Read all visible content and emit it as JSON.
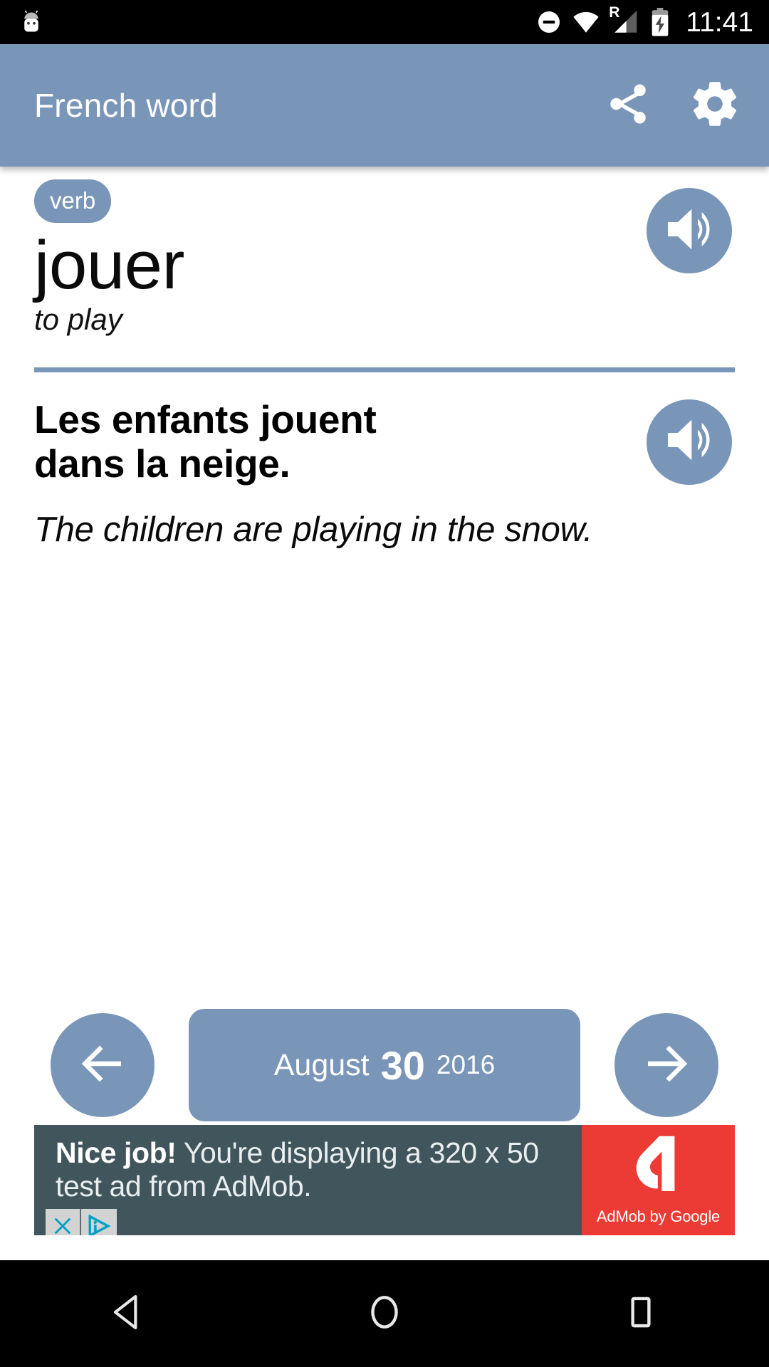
{
  "status_bar": {
    "notification_icon": "android-robot-icon",
    "dnd_icon": "do-not-disturb-icon",
    "wifi_icon": "wifi-icon",
    "roaming_label": "R",
    "signal_icon": "cellular-signal-icon",
    "battery_icon": "battery-charging-icon",
    "clock": "11:41"
  },
  "app_bar": {
    "title": "French word",
    "share_icon": "share-icon",
    "settings_icon": "gear-icon"
  },
  "word_card": {
    "part_of_speech": "verb",
    "headword": "jouer",
    "translation": "to play",
    "audio_icon": "speaker-volume-icon"
  },
  "example": {
    "sentence_source": "Les enfants jouent dans la neige.",
    "sentence_translation": "The children are playing in the snow.",
    "audio_icon": "speaker-volume-icon"
  },
  "date_nav": {
    "prev_icon": "arrow-left-icon",
    "next_icon": "arrow-right-icon",
    "month": "August",
    "day": "30",
    "year": "2016"
  },
  "ad": {
    "headline": "Nice job!",
    "body": " You're displaying a 320 x 50 test ad from AdMob.",
    "brand": "AdMob by Google",
    "close_icon": "close-x-icon",
    "info_icon": "adchoices-info-icon",
    "logo_icon": "admob-logo-icon"
  },
  "system_nav": {
    "back_icon": "back-triangle-icon",
    "home_icon": "home-circle-icon",
    "recents_icon": "recents-square-icon"
  },
  "colors": {
    "accent": "#7996b8",
    "status_bar": "#000000",
    "content_bg": "#ffffff",
    "ad_bg": "#40555c",
    "ad_logo_bg": "#eb3b34",
    "adchoices_cyan": "#00a0c6"
  }
}
